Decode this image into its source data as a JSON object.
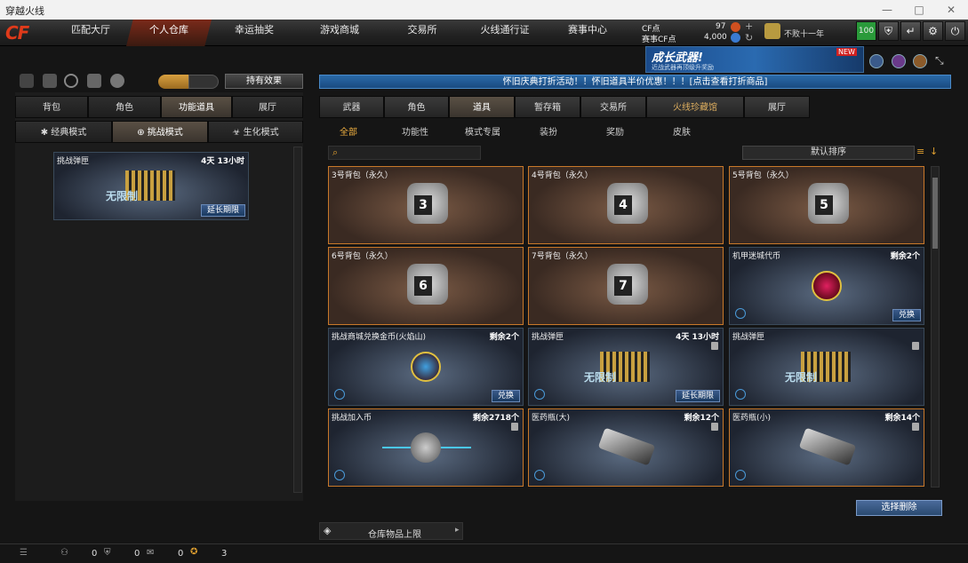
{
  "window": {
    "title": "穿越火线",
    "controls": [
      "—",
      "□",
      "✕"
    ]
  },
  "nav": {
    "logo": "CF",
    "tabs": [
      "匹配大厅",
      "个人仓库",
      "幸运抽奖",
      "游戏商城",
      "交易所",
      "火线通行证",
      "赛事中心"
    ],
    "active": 1
  },
  "currency": {
    "cf_label": "CF点",
    "cf_value": "97",
    "match_label": "赛事CF点",
    "match_value": "4,000"
  },
  "rank": {
    "title": "不败十一年"
  },
  "toolbar": {
    "level": "100"
  },
  "banner": {
    "text": "成长武器!",
    "sub": "近战武器再顶级升奖励",
    "tag": "NEW"
  },
  "marquee": "怀旧庆典打折活动！！怀旧道具半价优惠！！！[点击查看打折商品]",
  "left": {
    "effect_button": "持有效果",
    "tabs": [
      "背包",
      "角色",
      "功能道具",
      "展厅"
    ],
    "active_tab": 2,
    "modes": [
      "经典模式",
      "挑战模式",
      "生化模式"
    ],
    "active_mode": 1,
    "item": {
      "title": "挑战弹匣",
      "time": "4天 13小时",
      "label": "无限制",
      "button": "延长期限"
    }
  },
  "right": {
    "tabs": [
      "武器",
      "角色",
      "道具",
      "暂存箱",
      "交易所",
      "火线珍藏馆",
      "展厅"
    ],
    "active_tab": 2,
    "subtabs": [
      "全部",
      "功能性",
      "模式专属",
      "装扮",
      "奖励",
      "皮肤"
    ],
    "active_sub": 0,
    "search_placeholder": "",
    "sort_label": "默认排序",
    "items": [
      {
        "title": "3号背包（永久）",
        "kind": "bag",
        "num": "3",
        "sel": true
      },
      {
        "title": "4号背包（永久）",
        "kind": "bag",
        "num": "4",
        "sel": true
      },
      {
        "title": "5号背包（永久）",
        "kind": "bag",
        "num": "5",
        "sel": true
      },
      {
        "title": "6号背包（永久）",
        "kind": "bag",
        "num": "6",
        "sel": true
      },
      {
        "title": "7号背包（永久）",
        "kind": "bag",
        "num": "7",
        "sel": true
      },
      {
        "title": "机甲迷城代币",
        "kind": "coin",
        "right": "剩余2个",
        "button": "兑换"
      },
      {
        "title": "挑战商城兑换金币(火焰山)",
        "kind": "coin2",
        "right": "剩余2个",
        "button": "兑换"
      },
      {
        "title": "挑战弹匣",
        "kind": "ammo",
        "right": "4天 13小时",
        "button": "延长期限",
        "label": "无限制",
        "lock": true
      },
      {
        "title": "挑战弹匣",
        "kind": "ammo",
        "label": "无限制",
        "lock": true
      },
      {
        "title": "挑战加入币",
        "kind": "join",
        "right": "剩余2718个",
        "lock": true,
        "sel": true
      },
      {
        "title": "医药瓶(大)",
        "kind": "gun",
        "right": "剩余12个",
        "lock": true,
        "sel": true
      },
      {
        "title": "医药瓶(小)",
        "kind": "gun",
        "right": "剩余14个",
        "lock": true,
        "sel": true
      }
    ],
    "select_delete": "选择删除",
    "capacity": "仓库物品上限"
  },
  "status": {
    "counts": [
      "0",
      "0",
      "0",
      "3"
    ]
  },
  "colors": {
    "accent": "#c8782a",
    "blue": "#2a6aa8"
  }
}
